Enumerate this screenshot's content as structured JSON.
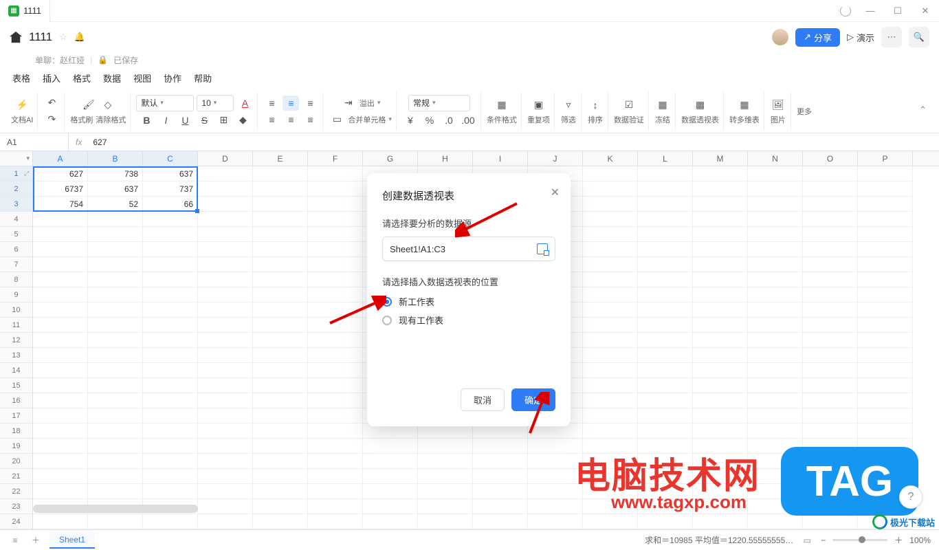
{
  "window": {
    "tab_title": "1111"
  },
  "header": {
    "doc_title": "1111",
    "subtitle_owner": "单聊：赵红娅",
    "subtitle_saved": "已保存",
    "share": "分享",
    "present": "演示"
  },
  "menubar": [
    "表格",
    "插入",
    "格式",
    "数据",
    "视图",
    "协作",
    "帮助"
  ],
  "ribbon": {
    "ai": "文档AI",
    "brush": "格式刷",
    "clear": "清除格式",
    "font_name": "默认",
    "font_size": "10",
    "overflow": "溢出",
    "merge": "合并单元格",
    "number_format": "常规",
    "cond": "条件格式",
    "dup": "重复项",
    "filter": "筛选",
    "sort": "排序",
    "valid": "数据验证",
    "freeze": "冻结",
    "pivot": "数据透视表",
    "multi": "转多维表",
    "image": "图片",
    "more": "更多"
  },
  "formula_bar": {
    "cell_ref": "A1",
    "value": "627"
  },
  "columns": [
    "A",
    "B",
    "C",
    "D",
    "E",
    "F",
    "G",
    "H",
    "I",
    "J",
    "K",
    "L",
    "M",
    "N",
    "O",
    "P"
  ],
  "rows": 24,
  "data": [
    [
      "627",
      "738",
      "637"
    ],
    [
      "6737",
      "637",
      "737"
    ],
    [
      "754",
      "52",
      "66"
    ]
  ],
  "dialog": {
    "title": "创建数据透视表",
    "src_label": "请选择要分析的数据源",
    "src_value": "Sheet1!A1:C3",
    "pos_label": "请选择插入数据透视表的位置",
    "opt_new": "新工作表",
    "opt_existing": "现有工作表",
    "cancel": "取消",
    "ok": "确定"
  },
  "watermark": {
    "big": "电脑技术网",
    "url": "www.tagxp.com",
    "tag": "TAG",
    "jiguang": "极光下载站"
  },
  "statusbar": {
    "sheet": "Sheet1",
    "stats": "求和＝10985  平均值＝1220.55555555…",
    "zoom": "100%"
  }
}
